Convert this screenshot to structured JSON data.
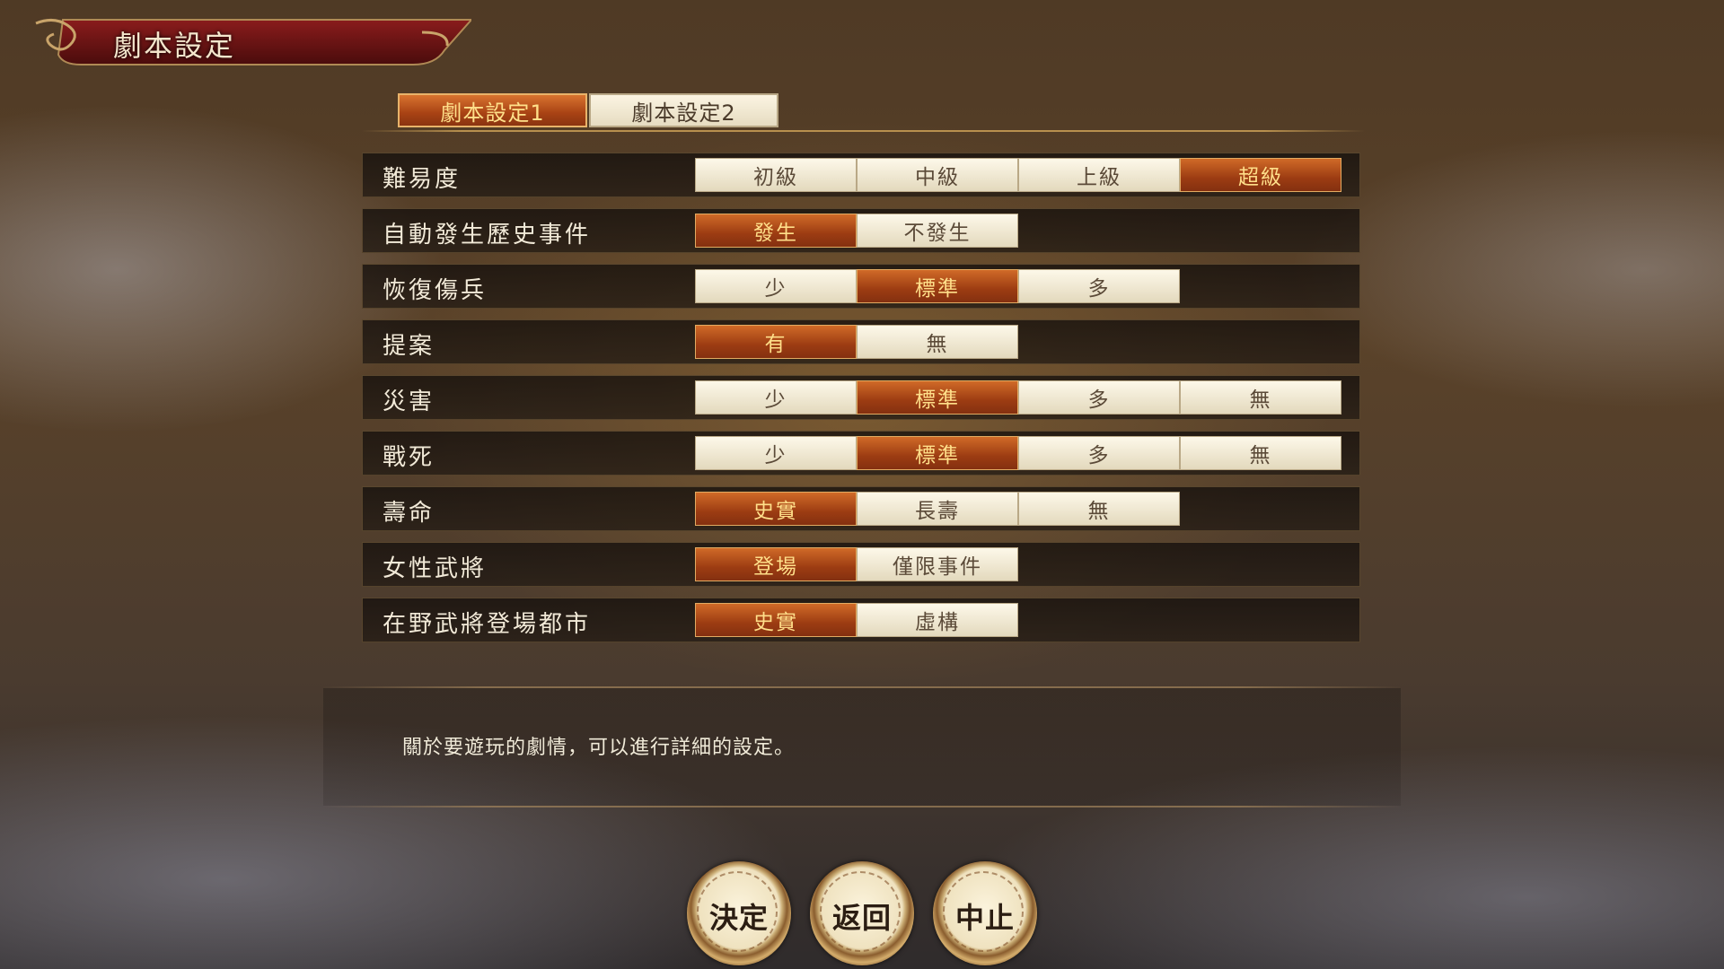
{
  "window": {
    "title": "劇本設定"
  },
  "tabs": [
    {
      "label": "劇本設定1",
      "active": true
    },
    {
      "label": "劇本設定2",
      "active": false
    }
  ],
  "settings": [
    {
      "label": "難易度",
      "options": [
        "初級",
        "中級",
        "上級",
        "超級"
      ],
      "selected": 3
    },
    {
      "label": "自動發生歷史事件",
      "options": [
        "發生",
        "不發生"
      ],
      "selected": 0
    },
    {
      "label": "恢復傷兵",
      "options": [
        "少",
        "標準",
        "多"
      ],
      "selected": 1
    },
    {
      "label": "提案",
      "options": [
        "有",
        "無"
      ],
      "selected": 0
    },
    {
      "label": "災害",
      "options": [
        "少",
        "標準",
        "多",
        "無"
      ],
      "selected": 1
    },
    {
      "label": "戰死",
      "options": [
        "少",
        "標準",
        "多",
        "無"
      ],
      "selected": 1
    },
    {
      "label": "壽命",
      "options": [
        "史實",
        "長壽",
        "無"
      ],
      "selected": 0
    },
    {
      "label": "女性武將",
      "options": [
        "登場",
        "僅限事件"
      ],
      "selected": 0
    },
    {
      "label": "在野武將登場都市",
      "options": [
        "史實",
        "虛構"
      ],
      "selected": 0
    }
  ],
  "description": "關於要遊玩的劇情，可以進行詳細的設定。",
  "buttons": {
    "confirm": "決定",
    "back": "返回",
    "cancel": "中止"
  },
  "colors": {
    "selected_bg": "#a84214",
    "selected_text": "#ffdf8a",
    "unselected_bg": "#f2ead3"
  }
}
